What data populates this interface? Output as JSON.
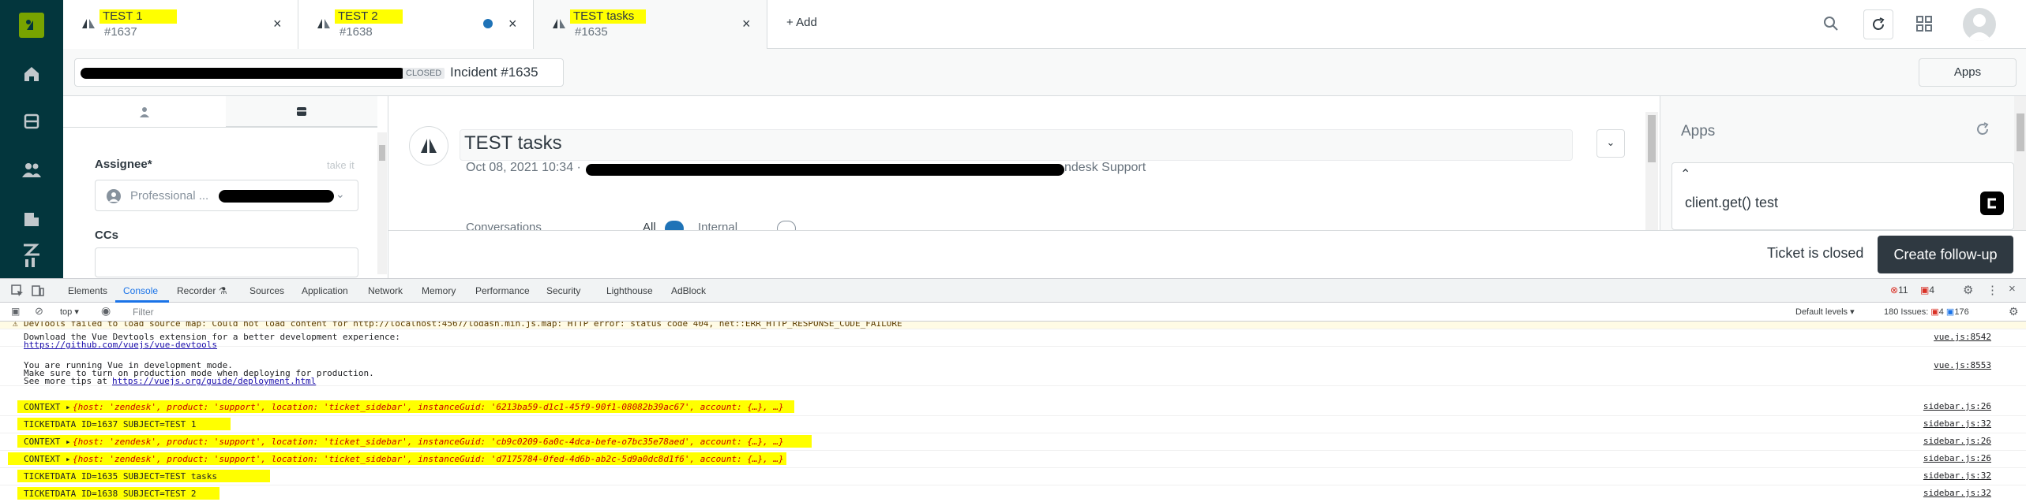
{
  "tabs": [
    {
      "title": "TEST 1",
      "number": "#1637",
      "close": "×"
    },
    {
      "title": "TEST 2",
      "number": "#1638",
      "close": "×"
    },
    {
      "title": "TEST tasks",
      "number": "#1635",
      "close": "×"
    }
  ],
  "add_tab_label": "+ Add",
  "subbar": {
    "closed_badge": "CLOSED",
    "incident_label": "Incident #1635",
    "apps_button": "Apps"
  },
  "left_panel": {
    "assignee_label": "Assignee*",
    "take_it": "take it",
    "assignee_value": "Professional ...",
    "ccs_label": "CCs"
  },
  "ticket": {
    "title": "TEST tasks",
    "date": "Oct 08, 2021 10:34 ·",
    "via": "ndesk Support",
    "conversations": "Conversations",
    "all_filter": "All",
    "internal_filter": "Internal"
  },
  "apps_panel": {
    "title": "Apps",
    "app_name": "client.get() test"
  },
  "footer": {
    "status": "Ticket is closed",
    "follow_up": "Create follow-up"
  },
  "devtools": {
    "tabs": [
      "Elements",
      "Console",
      "Recorder ⚗",
      "Sources",
      "Application",
      "Network",
      "Memory",
      "Performance",
      "Security",
      "Lighthouse",
      "AdBlock"
    ],
    "error_count": "11",
    "warn_count": "4",
    "context": "top ▾",
    "filter_placeholder": "Filter",
    "levels": "Default levels ▾",
    "issues": "180 Issues:",
    "issues_red": "4",
    "issues_blue": "176",
    "logs": [
      {
        "text": "DevTools failed to load source map: Could not load content for http://localhost:4567/lodash.min.js.map: HTTP error: status code 404, net::ERR_HTTP_RESPONSE_CODE_FAILURE",
        "src": ""
      },
      {
        "line1": "Download the Vue Devtools extension for a better development experience:",
        "link": "https://github.com/vuejs/vue-devtools",
        "src": "vue.js:8542"
      },
      {
        "line1": "You are running Vue in development mode.",
        "line2": "Make sure to turn on production mode when deploying for production.",
        "line3": "See more tips at ",
        "link": "https://vuejs.org/guide/deployment.html",
        "src": "vue.js:8553"
      },
      {
        "prefix": "CONTEXT ▸",
        "obj": "{host: 'zendesk', product: 'support', location: 'ticket_sidebar', instanceGuid: '6213ba59-d1c1-45f9-90f1-08082b39ac67', account: {…}, …}",
        "src": "sidebar.js:26"
      },
      {
        "text": "TICKETDATA ID=1637 SUBJECT=TEST 1",
        "src": "sidebar.js:32"
      },
      {
        "prefix": "CONTEXT ▸",
        "obj": "{host: 'zendesk', product: 'support', location: 'ticket_sidebar', instanceGuid: 'cb9c0209-6a0c-4dca-befe-o7bc35e78aed', account: {…}, …}",
        "src": "sidebar.js:26"
      },
      {
        "prefix": "CONTEXT ▸",
        "obj": "{host: 'zendesk', product: 'support', location: 'ticket_sidebar', instanceGuid: 'd7175784-0fed-4d6b-ab2c-5d9a0dc8d1f6', account: {…}, …}",
        "src": "sidebar.js:26"
      },
      {
        "text": "TICKETDATA ID=1635 SUBJECT=TEST tasks",
        "src": "sidebar.js:32"
      },
      {
        "text": "TICKETDATA ID=1638 SUBJECT=TEST 2",
        "src": "sidebar.js:32"
      }
    ]
  },
  "colors": {
    "nav": "#03363d",
    "accent": "#1f73b7",
    "highlight": "#ffff00",
    "follow_up_bg": "#2f3941"
  }
}
